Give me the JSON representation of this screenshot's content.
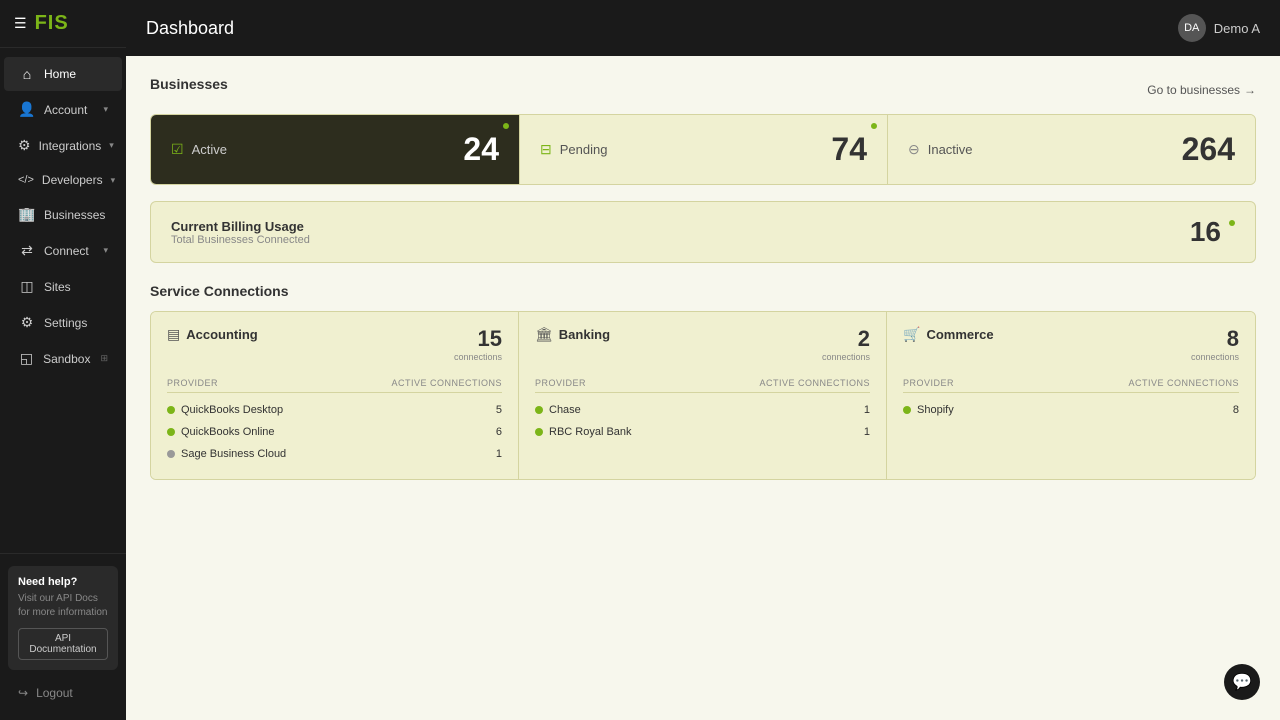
{
  "sidebar": {
    "logo": "FIS",
    "nav_items": [
      {
        "id": "home",
        "label": "Home",
        "icon": "⌂",
        "active": true,
        "has_chevron": false
      },
      {
        "id": "account",
        "label": "Account",
        "icon": "👤",
        "active": false,
        "has_chevron": true
      },
      {
        "id": "integrations",
        "label": "Integrations",
        "icon": "⚙",
        "active": false,
        "has_chevron": true
      },
      {
        "id": "developers",
        "label": "Developers",
        "icon": "⟨⟩",
        "active": false,
        "has_chevron": true
      },
      {
        "id": "businesses",
        "label": "Businesses",
        "icon": "🏢",
        "active": false,
        "has_chevron": false
      },
      {
        "id": "connect",
        "label": "Connect",
        "icon": "⇄",
        "active": false,
        "has_chevron": true
      },
      {
        "id": "sites",
        "label": "Sites",
        "icon": "◫",
        "active": false,
        "has_chevron": false
      },
      {
        "id": "settings",
        "label": "Settings",
        "icon": "⚙",
        "active": false,
        "has_chevron": false
      },
      {
        "id": "sandbox",
        "label": "Sandbox",
        "icon": "◱",
        "active": false,
        "has_chevron": false
      }
    ],
    "help": {
      "title": "Need help?",
      "description": "Visit our API Docs for more information",
      "button_label": "API Documentation"
    },
    "logout_label": "Logout"
  },
  "topbar": {
    "title": "Dashboard",
    "user_name": "Demo A",
    "user_initials": "DA"
  },
  "businesses": {
    "section_title": "Businesses",
    "go_to_businesses_label": "Go to businesses",
    "cards": [
      {
        "id": "active",
        "label": "Active",
        "count": "24",
        "type": "active"
      },
      {
        "id": "pending",
        "label": "Pending",
        "count": "74",
        "type": "pending"
      },
      {
        "id": "inactive",
        "label": "Inactive",
        "count": "264",
        "type": "inactive"
      }
    ]
  },
  "billing": {
    "title": "Current Billing Usage",
    "subtitle": "Total Businesses Connected",
    "count": "16"
  },
  "service_connections": {
    "section_title": "Service Connections",
    "cards": [
      {
        "id": "accounting",
        "title": "Accounting",
        "icon": "▤",
        "count": "15",
        "count_label": "connections",
        "providers_header": "PROVIDER",
        "connections_header": "ACTIVE CONNECTIONS",
        "providers": [
          {
            "name": "QuickBooks Desktop",
            "count": "5",
            "status": "green"
          },
          {
            "name": "QuickBooks Online",
            "count": "6",
            "status": "green"
          },
          {
            "name": "Sage Business Cloud",
            "count": "1",
            "status": "gray"
          }
        ]
      },
      {
        "id": "banking",
        "title": "Banking",
        "icon": "🏛",
        "count": "2",
        "count_label": "connections",
        "providers_header": "PROVIDER",
        "connections_header": "ACTIVE CONNECTIONS",
        "providers": [
          {
            "name": "Chase",
            "count": "1",
            "status": "green"
          },
          {
            "name": "RBC Royal Bank",
            "count": "1",
            "status": "green"
          }
        ]
      },
      {
        "id": "commerce",
        "title": "Commerce",
        "icon": "🛒",
        "count": "8",
        "count_label": "connections",
        "providers_header": "PROVIDER",
        "connections_header": "ACTIVE CONNECTIONS",
        "providers": [
          {
            "name": "Shopify",
            "count": "8",
            "status": "green"
          }
        ]
      }
    ]
  }
}
